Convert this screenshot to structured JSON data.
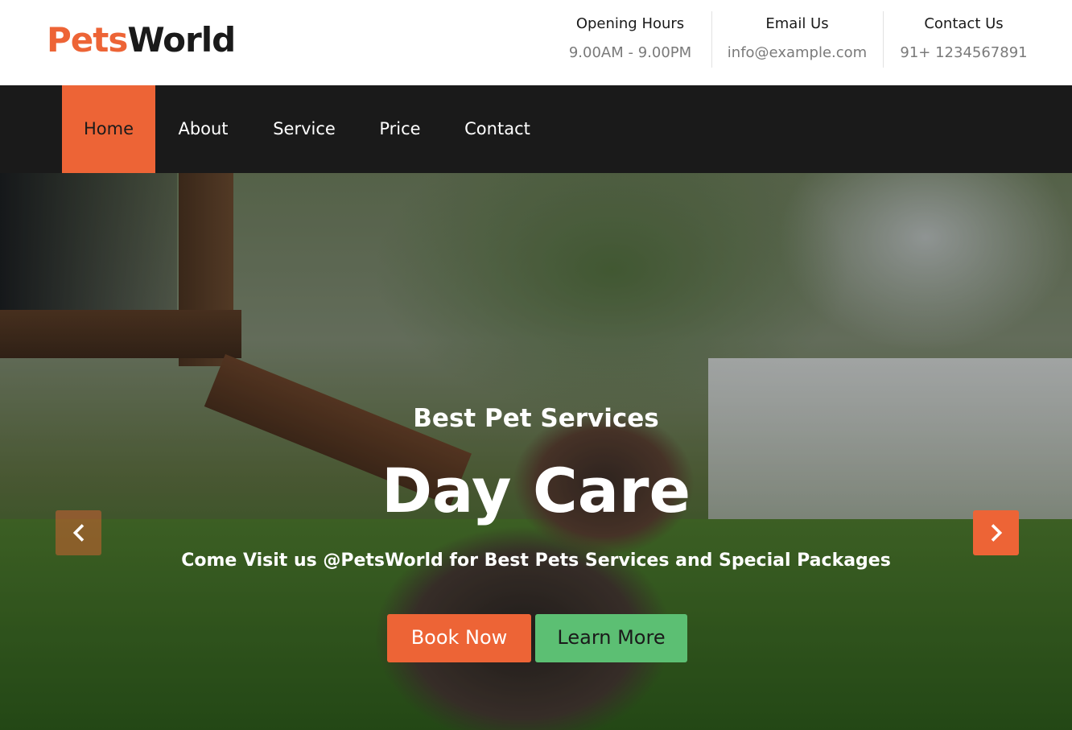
{
  "brand": {
    "part1": "Pets",
    "part2": "World"
  },
  "header": {
    "info": [
      {
        "title": "Opening Hours",
        "value": "9.00AM - 9.00PM"
      },
      {
        "title": "Email Us",
        "value": "info@example.com"
      },
      {
        "title": "Contact Us",
        "value": "91+ 1234567891"
      }
    ]
  },
  "nav": {
    "items": [
      {
        "label": "Home",
        "active": true
      },
      {
        "label": "About"
      },
      {
        "label": "Service"
      },
      {
        "label": "Price"
      },
      {
        "label": "Contact"
      }
    ]
  },
  "hero": {
    "subtitle": "Best Pet Services",
    "title": "Day Care",
    "description": "Come Visit us @PetsWorld for Best Pets Services and Special Packages",
    "primary_button": "Book Now",
    "secondary_button": "Learn More",
    "prev_icon": "chevron-left-icon",
    "next_icon": "chevron-right-icon"
  },
  "colors": {
    "accent": "#ed6436",
    "secondary": "#5cbf73",
    "dark": "#1a1a1a"
  }
}
